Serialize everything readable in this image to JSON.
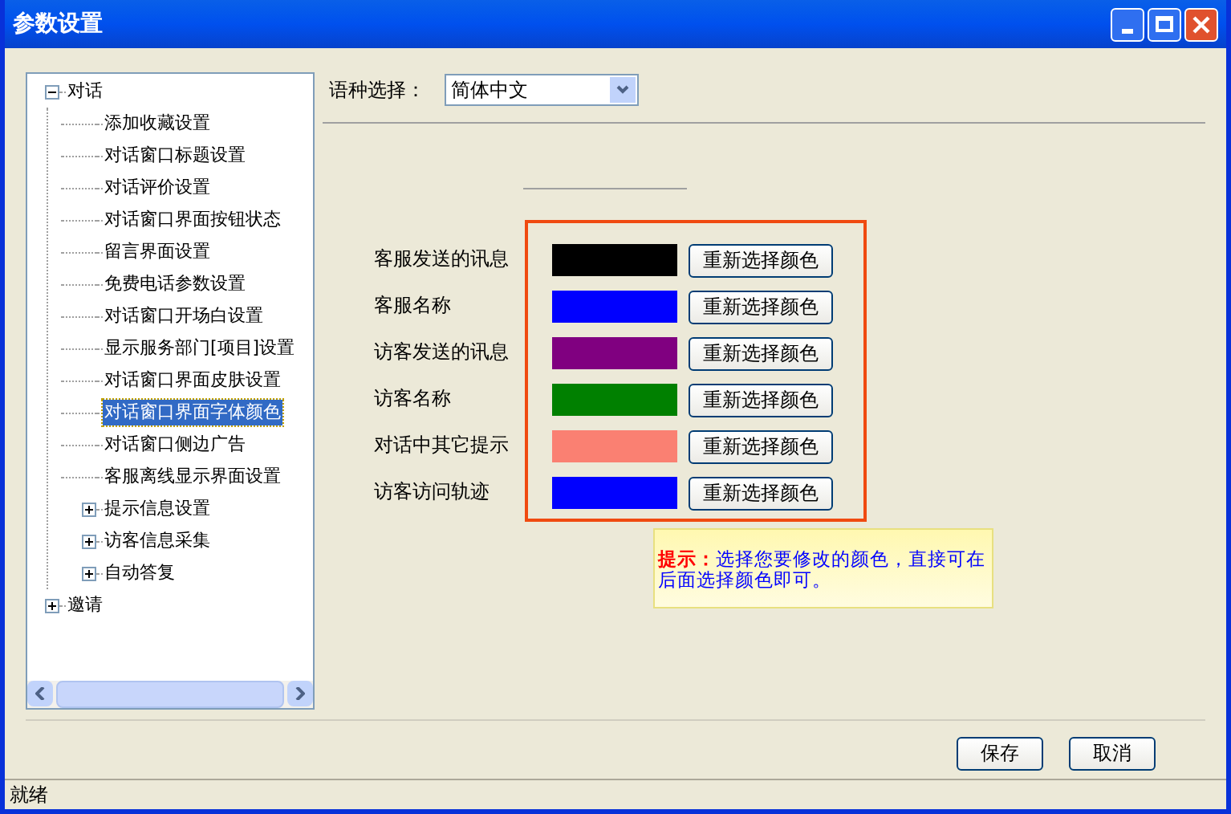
{
  "window": {
    "title": "参数设置"
  },
  "tree": [
    {
      "label": "对话",
      "selected": false,
      "expanded": true,
      "children": [
        {
          "label": "添加收藏设置",
          "selected": false
        },
        {
          "label": "对话窗口标题设置",
          "selected": false
        },
        {
          "label": "对话评价设置",
          "selected": false
        },
        {
          "label": "对话窗口界面按钮状态",
          "selected": false
        },
        {
          "label": "留言界面设置",
          "selected": false
        },
        {
          "label": "免费电话参数设置",
          "selected": false
        },
        {
          "label": "对话窗口开场白设置",
          "selected": false
        },
        {
          "label": "显示服务部门[项目]设置",
          "selected": false
        },
        {
          "label": "对话窗口界面皮肤设置",
          "selected": false
        },
        {
          "label": "对话窗口界面字体颜色",
          "selected": true
        },
        {
          "label": "对话窗口侧边广告",
          "selected": false
        },
        {
          "label": "客服离线显示界面设置",
          "selected": false
        },
        {
          "label": "提示信息设置",
          "selected": false,
          "expanded": false
        },
        {
          "label": "访客信息采集",
          "selected": false,
          "expanded": false
        },
        {
          "label": "自动答复",
          "selected": false,
          "expanded": false
        }
      ]
    },
    {
      "label": "邀请",
      "selected": false,
      "expanded": false
    }
  ],
  "language": {
    "label": "语种选择：",
    "value": "简体中文"
  },
  "colors": [
    {
      "label": "客服发送的讯息",
      "color": "#000000",
      "button": "重新选择颜色"
    },
    {
      "label": "客服名称",
      "color": "#0000ff",
      "button": "重新选择颜色"
    },
    {
      "label": "访客发送的讯息",
      "color": "#800080",
      "button": "重新选择颜色"
    },
    {
      "label": "访客名称",
      "color": "#008000",
      "button": "重新选择颜色"
    },
    {
      "label": "对话中其它提示",
      "color": "#fa8072",
      "button": "重新选择颜色"
    },
    {
      "label": "访客访问轨迹",
      "color": "#0000ff",
      "button": "重新选择颜色"
    }
  ],
  "hint": {
    "label": "提示：",
    "text": "选择您要修改的颜色，直接可在后面选择颜色即可。"
  },
  "buttons": [
    "保存",
    "取消"
  ],
  "status_bar": "就绪"
}
